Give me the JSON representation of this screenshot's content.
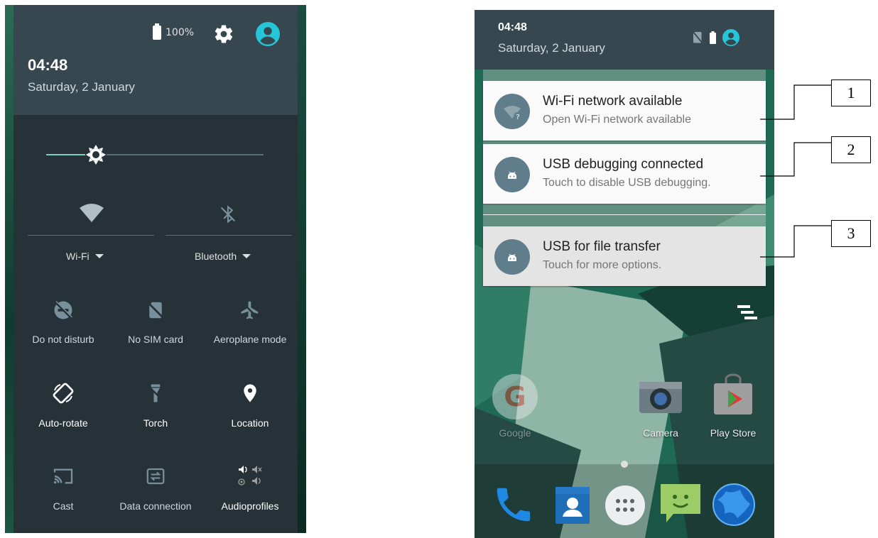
{
  "quick_settings": {
    "battery_percent": "100%",
    "time": "04:48",
    "date": "Saturday, 2 January",
    "brightness_level": 0.23,
    "wifi_label": "Wi-Fi",
    "bluetooth_label": "Bluetooth",
    "tiles": [
      {
        "label": "Do not disturb",
        "icon": "do-not-disturb-icon",
        "active": false
      },
      {
        "label": "No SIM card",
        "icon": "no-sim-icon",
        "active": false
      },
      {
        "label": "Aeroplane mode",
        "icon": "airplane-icon",
        "active": false
      },
      {
        "label": "Auto-rotate",
        "icon": "auto-rotate-icon",
        "active": true
      },
      {
        "label": "Torch",
        "icon": "torch-icon",
        "active": false
      },
      {
        "label": "Location",
        "icon": "location-icon",
        "active": true
      },
      {
        "label": "Cast",
        "icon": "cast-icon",
        "active": false
      },
      {
        "label": "Data connection",
        "icon": "data-connection-icon",
        "active": false
      },
      {
        "label": "Audioprofiles",
        "icon": "audioprofiles-icon",
        "active": true
      }
    ]
  },
  "notification_shade": {
    "time": "04:48",
    "date": "Saturday, 2 January",
    "notifications": [
      {
        "title": "Wi-Fi network available",
        "text": "Open Wi-Fi network available",
        "icon": "wifi-question-icon"
      },
      {
        "title": "USB debugging connected",
        "text": "Touch to disable USB debugging.",
        "icon": "android-icon"
      },
      {
        "title": "USB for file transfer",
        "text": "Touch for more options.",
        "icon": "android-icon"
      }
    ],
    "apps": [
      {
        "label": "Google",
        "icon": "google-icon"
      },
      {
        "label": "Camera",
        "icon": "camera-icon"
      },
      {
        "label": "Play Store",
        "icon": "play-store-icon"
      }
    ],
    "dock": [
      "phone-icon",
      "contacts-icon",
      "app-drawer-icon",
      "messaging-icon",
      "browser-icon"
    ]
  },
  "callouts": [
    "1",
    "2",
    "3"
  ],
  "colors": {
    "panel_bg": "#263238",
    "header_bg": "#37474f",
    "accent": "#80cbc4",
    "avatar": "#26c6da",
    "notification_icon_bg": "#607d8b"
  }
}
